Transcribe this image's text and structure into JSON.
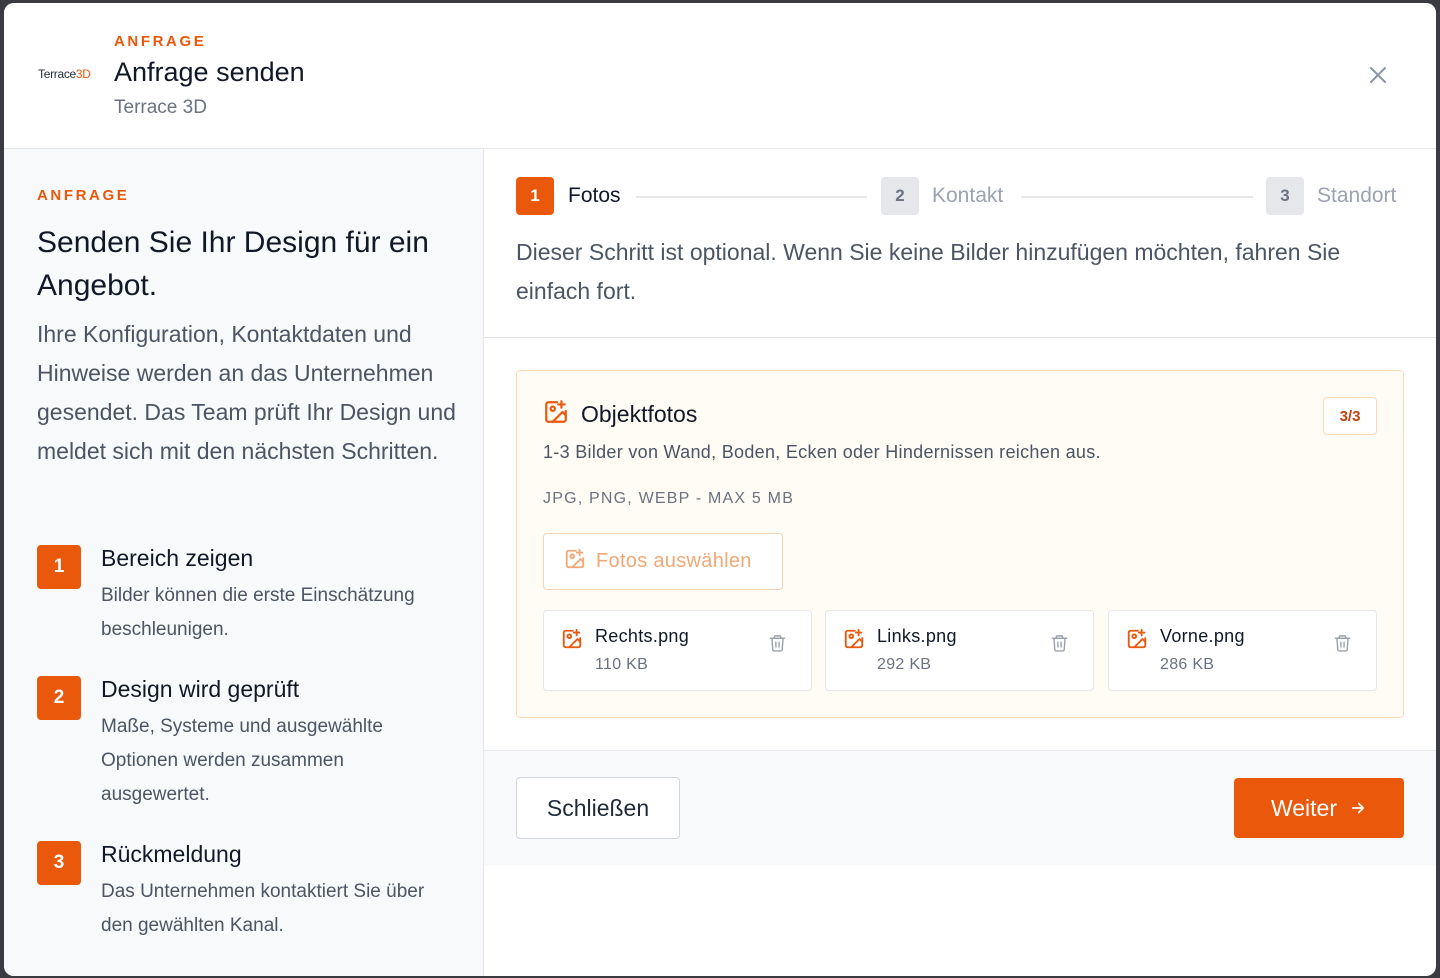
{
  "header": {
    "logo_text_main": "Terrace",
    "logo_text_accent": "3D",
    "eyebrow": "ANFRAGE",
    "title": "Anfrage senden",
    "subtitle": "Terrace 3D"
  },
  "left": {
    "eyebrow": "ANFRAGE",
    "headline": "Senden Sie Ihr Design für ein Angebot.",
    "description": "Ihre Konfiguration, Kontaktdaten und Hinweise werden an das Unternehmen gesendet. Das Team prüft Ihr Design und meldet sich mit den nächsten Schritten.",
    "items": [
      {
        "num": "1",
        "title": "Bereich zeigen",
        "desc": "Bilder können die erste Einschätzung beschleunigen."
      },
      {
        "num": "2",
        "title": "Design wird geprüft",
        "desc": "Maße, Systeme und ausgewählte Optionen werden zusammen ausgewertet."
      },
      {
        "num": "3",
        "title": "Rückmeldung",
        "desc": "Das Unternehmen kontaktiert Sie über den gewählten Kanal."
      }
    ]
  },
  "stepper": {
    "steps": [
      {
        "num": "1",
        "label": "Fotos",
        "state": "active"
      },
      {
        "num": "2",
        "label": "Kontakt",
        "state": "inactive"
      },
      {
        "num": "3",
        "label": "Standort",
        "state": "inactive"
      }
    ]
  },
  "main": {
    "optional_note": "Dieser Schritt ist optional. Wenn Sie keine Bilder hinzufügen möchten, fahren Sie einfach fort.",
    "upload": {
      "title": "Objektfotos",
      "count": "3/3",
      "hint": "1-3 Bilder von Wand, Boden, Ecken oder Hindernissen reichen aus.",
      "formats": "JPG, PNG, WEBP - MAX 5 MB",
      "select_label": "Fotos auswählen",
      "files": [
        {
          "name": "Rechts.png",
          "size": "110 KB"
        },
        {
          "name": "Links.png",
          "size": "292 KB"
        },
        {
          "name": "Vorne.png",
          "size": "286 KB"
        }
      ]
    }
  },
  "footer": {
    "close_label": "Schließen",
    "next_label": "Weiter"
  },
  "colors": {
    "accent": "#ea580c",
    "card_bg": "#fffbf5",
    "card_border": "#fcd9b6"
  }
}
